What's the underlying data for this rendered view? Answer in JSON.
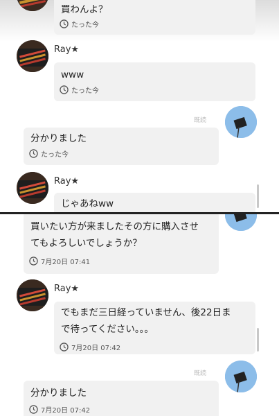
{
  "top_panel": {
    "messages": [
      {
        "text": "買わんよ？",
        "time": "たった今"
      },
      {
        "sender": "Ray★",
        "text": "www",
        "time": "たった今"
      },
      {
        "text": "分かりました",
        "time": "たった今"
      },
      {
        "sender": "Ray★",
        "text": "じゃあねww"
      }
    ],
    "read_label": "既読"
  },
  "bottom_panel": {
    "messages": [
      {
        "text_line1": "買いたい方が来ましたその方に購入させ",
        "text_line2": "てもよろしいでしょうか？",
        "time": "7月20日 07:41"
      },
      {
        "sender": "Ray★",
        "text_line1": "でもまだ三日経っていません、後22日ま",
        "text_line2": "で待ってください。。。",
        "time": "7月20日 07:42"
      },
      {
        "text": "分かりました",
        "time": "7月20日 07:42"
      }
    ],
    "read_label": "既読"
  },
  "colors": {
    "bubble": "#f1f1f1",
    "divider": "#222222",
    "meta_text": "#555555"
  },
  "icons": {
    "avatar_ray": "pen-case-photo",
    "avatar_me": "sky-photo",
    "time": "clock-icon"
  }
}
